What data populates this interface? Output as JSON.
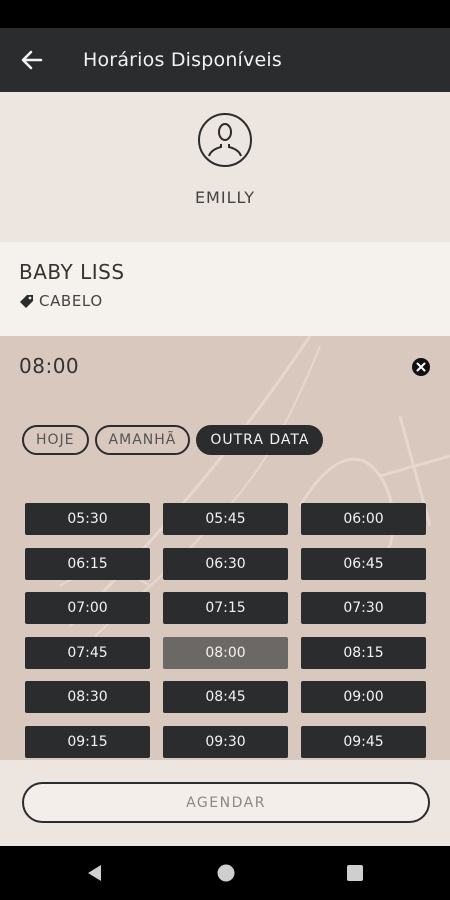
{
  "header": {
    "title": "Horários Disponíveis"
  },
  "professional": {
    "name": "EMILLY"
  },
  "service": {
    "name": "BABY LISS",
    "category": "CABELO"
  },
  "schedule": {
    "selected_time": "08:00",
    "date_filters": [
      {
        "label": "HOJE",
        "active": false
      },
      {
        "label": "AMANHÃ",
        "active": false
      },
      {
        "label": "OUTRA DATA",
        "active": true
      }
    ],
    "slots": [
      {
        "time": "05:30",
        "selected": false
      },
      {
        "time": "05:45",
        "selected": false
      },
      {
        "time": "06:00",
        "selected": false
      },
      {
        "time": "06:15",
        "selected": false
      },
      {
        "time": "06:30",
        "selected": false
      },
      {
        "time": "06:45",
        "selected": false
      },
      {
        "time": "07:00",
        "selected": false
      },
      {
        "time": "07:15",
        "selected": false
      },
      {
        "time": "07:30",
        "selected": false
      },
      {
        "time": "07:45",
        "selected": false
      },
      {
        "time": "08:00",
        "selected": true
      },
      {
        "time": "08:15",
        "selected": false
      },
      {
        "time": "08:30",
        "selected": false
      },
      {
        "time": "08:45",
        "selected": false
      },
      {
        "time": "09:00",
        "selected": false
      },
      {
        "time": "09:15",
        "selected": false
      },
      {
        "time": "09:30",
        "selected": false
      },
      {
        "time": "09:45",
        "selected": false
      }
    ]
  },
  "footer": {
    "submit_label": "AGENDAR"
  },
  "icons": {
    "back": "arrow-left-icon",
    "avatar": "user-circle-icon",
    "category": "tag-icon",
    "clear": "close-circle-icon",
    "nav_back": "triangle-back-icon",
    "nav_home": "circle-home-icon",
    "nav_recents": "square-recents-icon"
  },
  "colors": {
    "app_bar": "#2b2c2e",
    "profile_bg": "#ede5e0",
    "schedule_bg": "#d9c8bd",
    "slot_bg": "#2b2c2e",
    "slot_selected": "#6b6866"
  }
}
